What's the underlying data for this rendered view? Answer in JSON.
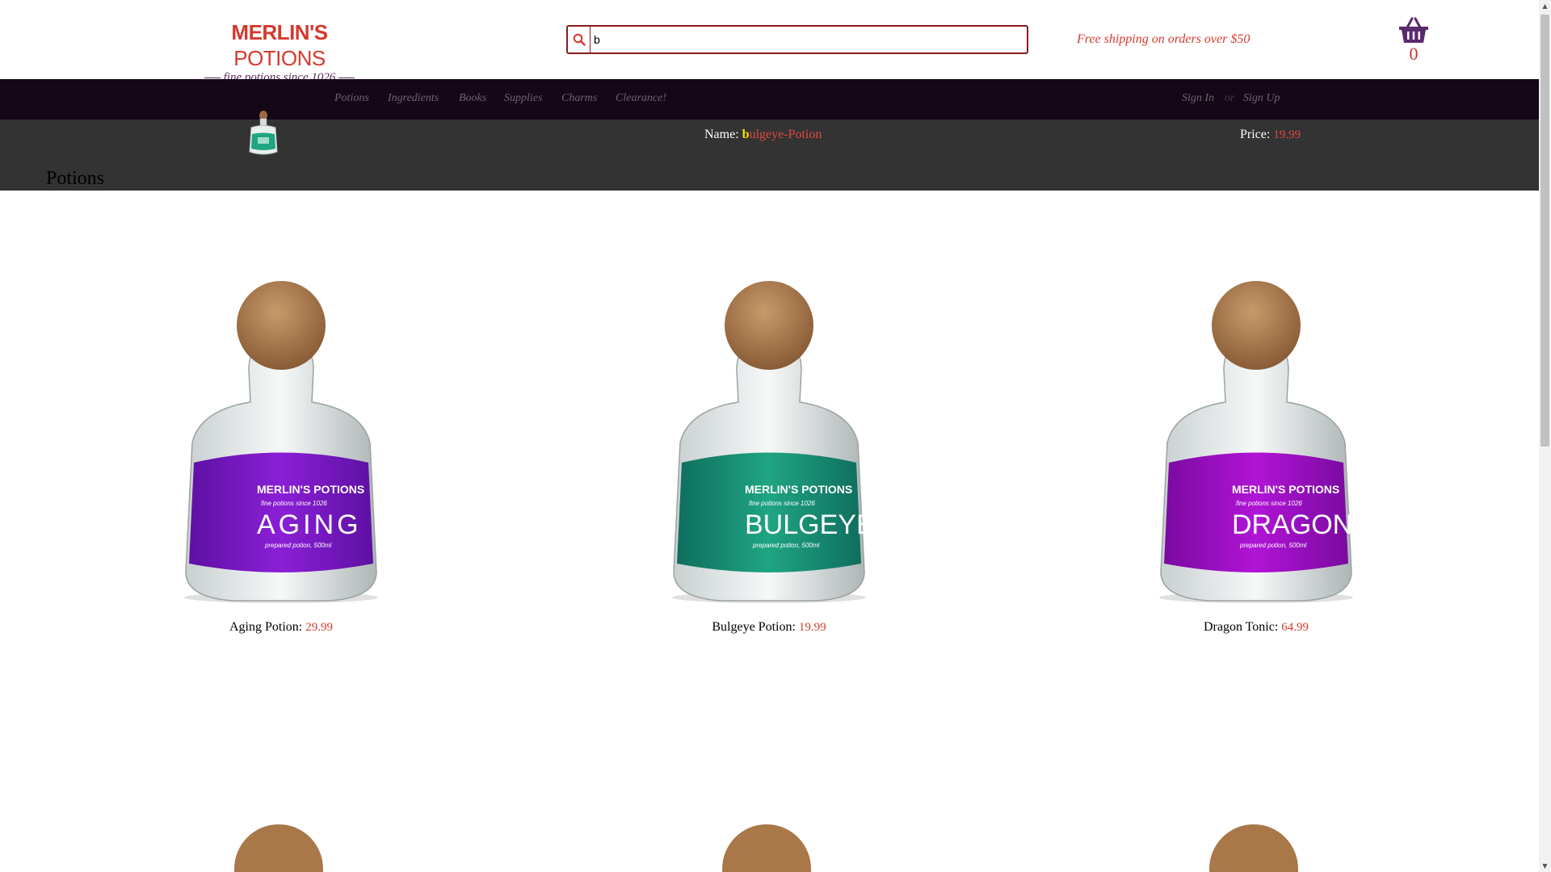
{
  "header": {
    "logo_title_bold": "MERLIN'S",
    "logo_title_rest": " POTIONS",
    "logo_tagline": "fine potions since 1026",
    "search_value": "b",
    "shipping_text": "Free shipping on orders over $50",
    "cart_count": "0"
  },
  "nav": {
    "items": [
      "Potions",
      "Ingredients",
      "Books",
      "Supplies",
      "Charms",
      "Clearance!"
    ],
    "sign_in": "Sign In",
    "or": "or",
    "sign_up": "Sign Up"
  },
  "suggestion": {
    "name_label": "Name:",
    "name_highlight": "b",
    "name_rest": "ulgeye-Potion",
    "price_label": "Price:",
    "price_value": "19.99"
  },
  "section": {
    "title": "Potions"
  },
  "products": [
    {
      "name": "Aging Potion:",
      "price": "29.99",
      "label": "AGING",
      "liquid": "#8a1fd6",
      "liquid_dark": "#5e10a3"
    },
    {
      "name": "Bulgeye Potion:",
      "price": "19.99",
      "label": "BULGEYE",
      "liquid": "#1fa582",
      "liquid_dark": "#0f6e5e"
    },
    {
      "name": "Dragon Tonic:",
      "price": "64.99",
      "label": "DRAGON",
      "liquid": "#b014d6",
      "liquid_dark": "#7a0aa0"
    }
  ],
  "bottle_brand": "MERLIN'S POTIONS",
  "bottle_tagline": "fine potions since 1026",
  "bottle_sub": "prepared potion, 500ml",
  "colors": {
    "brand_red": "#d43a2f",
    "nav_bg": "#140717",
    "suggest_bg": "#333333",
    "highlight": "#f1e100",
    "cart": "#5a2a6f"
  },
  "icons": {
    "search": "search-icon",
    "cart": "basket-icon"
  }
}
